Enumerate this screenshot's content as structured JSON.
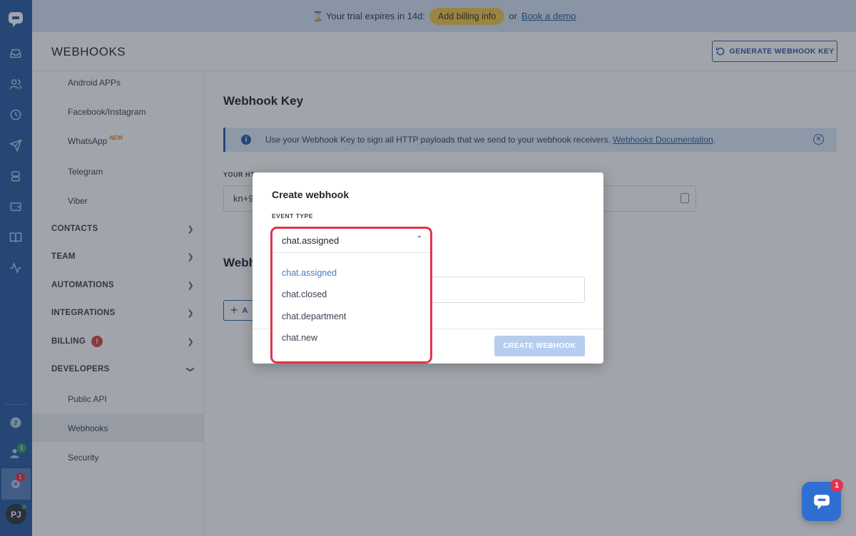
{
  "banner": {
    "trial_text": "⌛ Your trial expires in 14d:",
    "billing_button": "Add billing info",
    "or_text": "or",
    "demo_link": "Book a demo"
  },
  "header": {
    "title": "WEBHOOKS",
    "generate_button": "GENERATE WEBHOOK KEY"
  },
  "sidebar": {
    "sub_items": [
      {
        "label": "Android APPs"
      },
      {
        "label": "Facebook/Instagram"
      },
      {
        "label": "WhatsApp",
        "tag": "NEW"
      },
      {
        "label": "Telegram"
      },
      {
        "label": "Viber"
      }
    ],
    "sections": [
      {
        "label": "CONTACTS"
      },
      {
        "label": "TEAM"
      },
      {
        "label": "AUTOMATIONS"
      },
      {
        "label": "INTEGRATIONS"
      },
      {
        "label": "BILLING",
        "badge": "!"
      },
      {
        "label": "DEVELOPERS"
      }
    ],
    "dev_items": [
      {
        "label": "Public API"
      },
      {
        "label": "Webhooks"
      },
      {
        "label": "Security"
      }
    ]
  },
  "main": {
    "title": "Webhook Key",
    "info_text": "Use your Webhook Key to sign all HTTP payloads that we send to your webhook receivers.",
    "info_link": "Webhooks Documentation",
    "info_suffix": ".",
    "key_label": "YOUR HT",
    "key_value": "kn+9",
    "webhooks_heading": "Webh",
    "add_button": "A"
  },
  "modal": {
    "title": "Create webhook",
    "event_type_label": "EVENT TYPE",
    "selected_event": "chat.assigned",
    "options": [
      "chat.assigned",
      "chat.closed",
      "chat.department",
      "chat.new"
    ],
    "create_button": "CREATE WEBHOOK"
  },
  "rail": {
    "badges": {
      "team": "1",
      "settings": "1"
    },
    "avatar_initials": "PJ"
  },
  "chat_widget": {
    "badge": "1"
  },
  "colors": {
    "brand": "#2c5ea3",
    "accent_yellow": "#f2c94c",
    "alert_red": "#e4334a"
  }
}
